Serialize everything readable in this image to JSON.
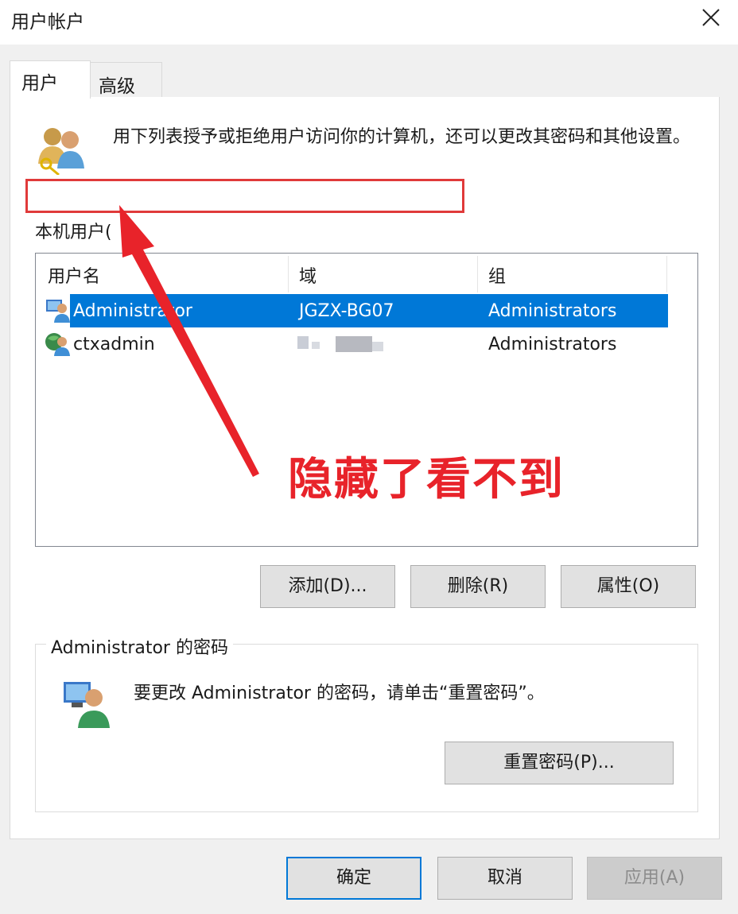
{
  "window": {
    "title": "用户帐户",
    "close_icon": "close-icon"
  },
  "tabs": [
    {
      "label": "用户",
      "active": true
    },
    {
      "label": "高级",
      "active": false
    }
  ],
  "description": "用下列表授予或拒绝用户访问你的计算机，还可以更改其密码和其他设置。",
  "local_users_label": "本机用户(",
  "list": {
    "columns": [
      "用户名",
      "域",
      "组"
    ],
    "rows": [
      {
        "username": "Administrator",
        "domain": "JGZX-BG07",
        "group": "Administrators",
        "selected": true,
        "icon": "admin-user-icon"
      },
      {
        "username": "ctxadmin",
        "domain": "",
        "group": "Administrators",
        "selected": false,
        "icon": "domain-user-icon"
      }
    ]
  },
  "buttons": {
    "add": "添加(D)...",
    "remove": "删除(R)",
    "properties": "属性(O)",
    "reset_password": "重置密码(P)...",
    "ok": "确定",
    "cancel": "取消",
    "apply": "应用(A)"
  },
  "password_group": {
    "title": "Administrator 的密码",
    "text": "要更改 Administrator 的密码，请单击“重置密码”。"
  },
  "annotation": {
    "text": "隐藏了看不到",
    "color": "#e8232a"
  },
  "colors": {
    "selection": "#0078d7",
    "annotation_red": "#e03a3a"
  }
}
